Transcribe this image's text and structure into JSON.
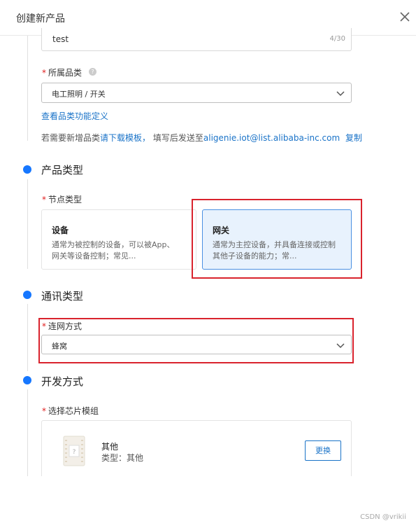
{
  "dialog": {
    "title": "创建新产品"
  },
  "product_name": {
    "value": "test",
    "count": "4/30"
  },
  "category": {
    "required_mark": "*",
    "label": "所属品类",
    "help_icon": "question-icon",
    "selected": "电工照明 / 开关",
    "view_link": "查看品类功能定义",
    "note_prefix": "若需要新增品类",
    "note_link": "请下载模板，",
    "note_middle": "填写后发送至",
    "note_email": "aligenie.iot@list.alibaba-inc.com",
    "note_copy": "复制"
  },
  "product_type": {
    "section_title": "产品类型",
    "node_label": "节点类型",
    "required_mark": "*",
    "options": [
      {
        "title": "设备",
        "desc": "通常为被控制的设备，可以被App、网关等设备控制；常见..."
      },
      {
        "title": "网关",
        "desc": "通常为主控设备，并具备连接或控制其他子设备的能力；常..."
      }
    ],
    "selected_index": 1
  },
  "comm_type": {
    "section_title": "通讯类型",
    "network_label": "连网方式",
    "required_mark": "*",
    "selected": "蜂窝"
  },
  "dev_mode": {
    "section_title": "开发方式",
    "chip_label": "选择芯片模组",
    "required_mark": "*",
    "chip": {
      "name": "其他",
      "type": "类型：其他",
      "change_button": "更换"
    }
  },
  "watermark": "CSDN @vrikii",
  "colors": {
    "accent": "#1677ff",
    "link": "#1a73c8",
    "highlight": "#d9232d",
    "selected_bg": "#e8f2fd"
  }
}
